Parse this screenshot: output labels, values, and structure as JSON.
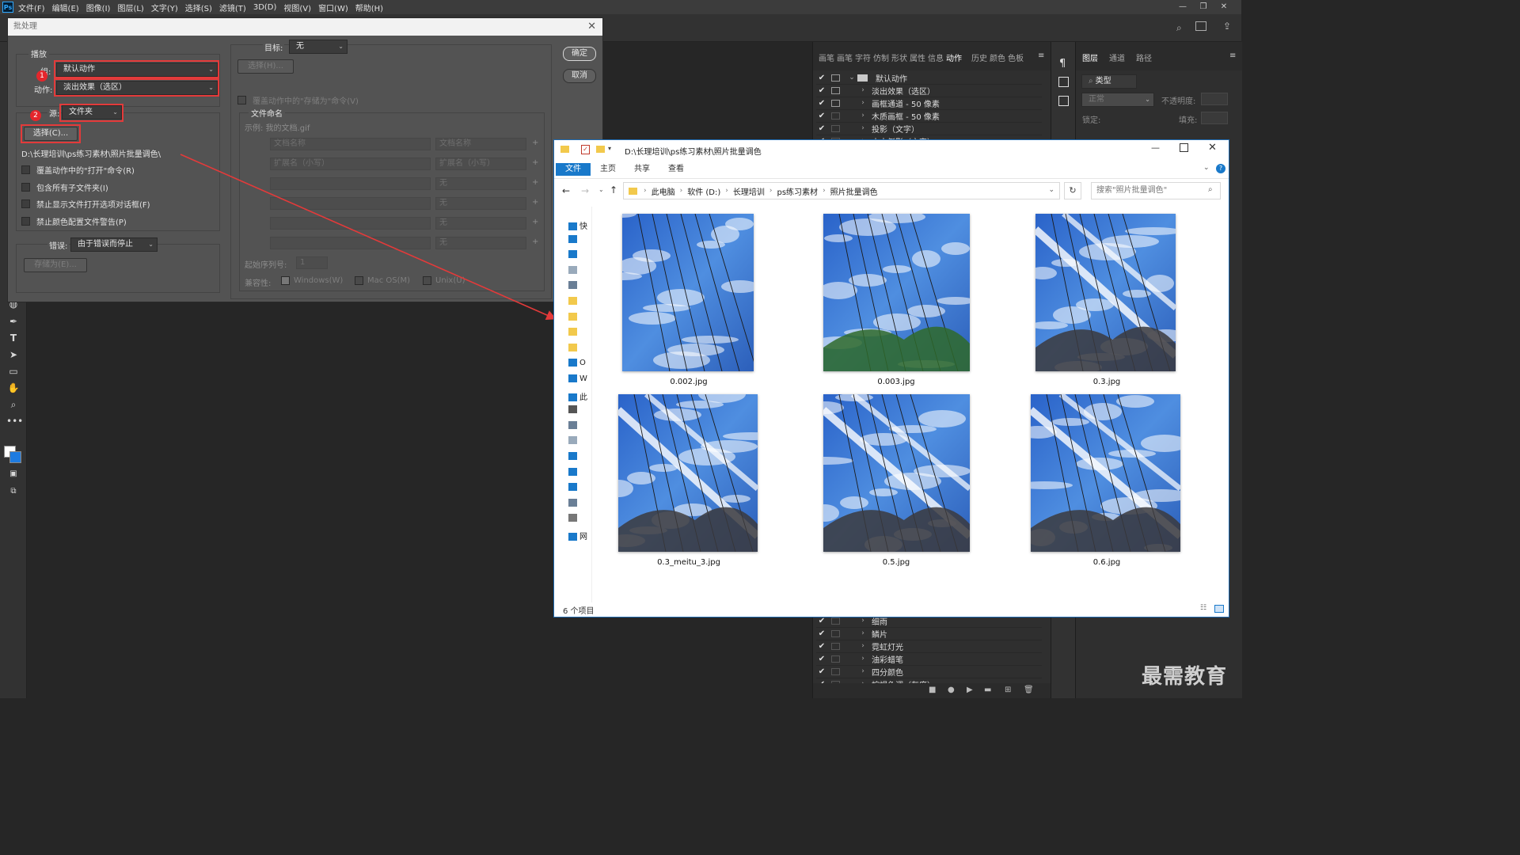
{
  "app": {
    "logo": "Ps",
    "menu": [
      "文件(F)",
      "编辑(E)",
      "图像(I)",
      "图层(L)",
      "文字(Y)",
      "选择(S)",
      "滤镜(T)",
      "3D(D)",
      "视图(V)",
      "窗口(W)",
      "帮助(H)"
    ]
  },
  "dialog": {
    "title": "批处理",
    "play_group": "播放",
    "set_label": "组:",
    "set_value": "默认动作",
    "action_label": "动作:",
    "action_value": "淡出效果（选区）",
    "source_label": "源:",
    "source_value": "文件夹",
    "choose_button": "选择(C)...",
    "source_path": "D:\\长理培训\\ps练习素材\\照片批量调色\\",
    "checkboxes": [
      "覆盖动作中的\"打开\"命令(R)",
      "包含所有子文件夹(I)",
      "禁止显示文件打开选项对话框(F)",
      "禁止颜色配置文件警告(P)"
    ],
    "error_label": "错误:",
    "error_value": "由于错误而停止",
    "save_as_button": "存储为(E)...",
    "dest_label": "目标:",
    "dest_value": "无",
    "dest_choose_button": "选择(H)...",
    "override_save": "覆盖动作中的\"存储为\"命令(V)",
    "file_naming_group": "文件命名",
    "example": "示例: 我的文档.gif",
    "naming_fields": [
      [
        "文档名称",
        "文档名称"
      ],
      [
        "扩展名（小写）",
        "扩展名（小写）"
      ],
      [
        "",
        "无"
      ],
      [
        "",
        "无"
      ],
      [
        "",
        "无"
      ],
      [
        "",
        "无"
      ]
    ],
    "serial_label": "起始序列号:",
    "serial_value": "1",
    "compat_label": "兼容性:",
    "compat_options": [
      "Windows(W)",
      "Mac OS(M)",
      "Unix(U)"
    ],
    "ok_button": "确定",
    "cancel_button": "取消",
    "badges": [
      "1",
      "2"
    ]
  },
  "actions_panel": {
    "tabs": [
      "画笔",
      "画笔",
      "字符",
      "仿制",
      "形状",
      "属性",
      "信息",
      "动作",
      "历史",
      "颜色",
      "色板"
    ],
    "active_tab": "动作",
    "rows_top": [
      {
        "name": "默认动作",
        "folder": true,
        "dlg": true
      },
      {
        "name": "淡出效果（选区）",
        "folder": false,
        "dlg": true
      },
      {
        "name": "画框通道 - 50 像素",
        "folder": false,
        "dlg": true
      },
      {
        "name": "木质画框 - 50 像素",
        "folder": false,
        "dlg": false
      },
      {
        "name": "投影（文字）",
        "folder": false,
        "dlg": false
      },
      {
        "name": "水中倒影（文字）",
        "folder": false,
        "dlg": false
      }
    ],
    "rows_bottom": [
      {
        "name": "细雨"
      },
      {
        "name": "鳞片"
      },
      {
        "name": "霓虹灯光"
      },
      {
        "name": "油彩蜡笔"
      },
      {
        "name": "四分颜色"
      },
      {
        "name": "棕褐色调（灰度）"
      }
    ]
  },
  "layers_panel": {
    "tabs": [
      "图层",
      "通道",
      "路径"
    ],
    "kind_label": "类型",
    "blend_mode": "正常",
    "opacity_label": "不透明度:",
    "lock_label": "锁定:",
    "fill_label": "填充:"
  },
  "explorer": {
    "title_path": "D:\\长理培训\\ps练习素材\\照片批量调色",
    "ribbon_tabs": [
      "文件",
      "主页",
      "共享",
      "查看"
    ],
    "breadcrumb": [
      "此电脑",
      "软件 (D:)",
      "长理培训",
      "ps练习素材",
      "照片批量调色"
    ],
    "search_placeholder": "搜索\"照片批量调色\"",
    "nav_items": [
      "快",
      "",
      "",
      "",
      "",
      "",
      "",
      "",
      "",
      "O",
      "W",
      "此",
      "",
      "",
      "",
      "",
      "",
      "",
      "",
      "",
      "网"
    ],
    "files": [
      {
        "name": "0.002.jpg"
      },
      {
        "name": "0.003.jpg"
      },
      {
        "name": "0.3.jpg"
      },
      {
        "name": "0.3_meitu_3.jpg"
      },
      {
        "name": "0.5.jpg"
      },
      {
        "name": "0.6.jpg"
      }
    ],
    "status": "6 个项目"
  },
  "watermark": "最需教育",
  "colors": {
    "highlight_red": "#e33a3a",
    "ribbon_blue": "#1979ca",
    "sky_blue": "#2f6fd0"
  }
}
